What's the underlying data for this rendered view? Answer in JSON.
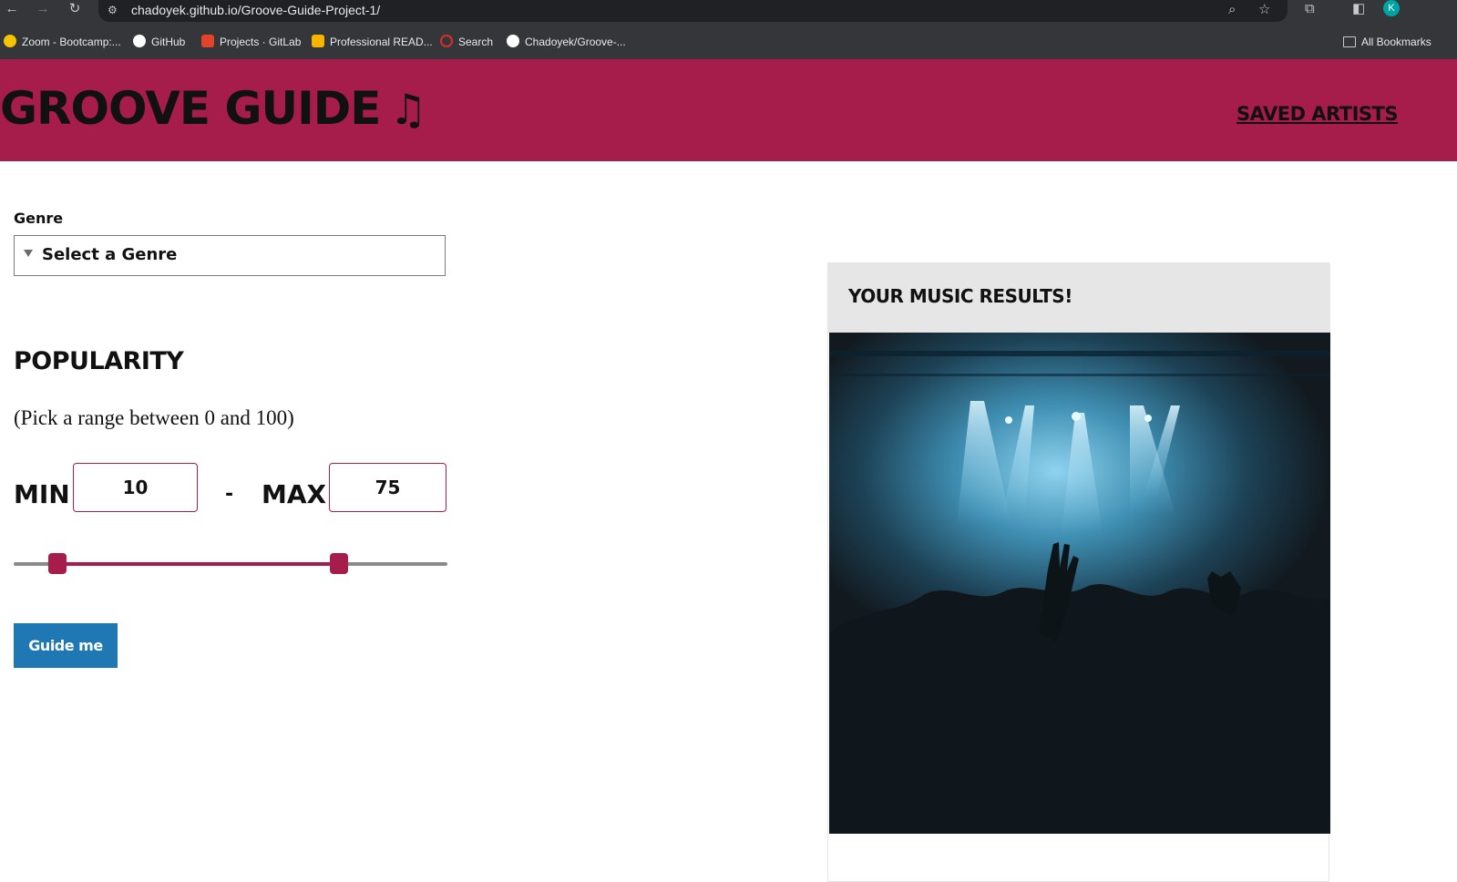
{
  "browser": {
    "url": "chadoyek.github.io/Groove-Guide-Project-1/",
    "profile_initial": "K"
  },
  "bookmarks": [
    {
      "label": "Zoom - Bootcamp:...",
      "icon": "zoom-icon",
      "color": "#f5c400"
    },
    {
      "label": "GitHub",
      "icon": "github-icon",
      "color": "#ffffff"
    },
    {
      "label": "Projects · GitLab",
      "icon": "gitlab-icon",
      "color": "#e24329"
    },
    {
      "label": "Professional READ...",
      "icon": "readme-icon",
      "color": "#f7b500"
    },
    {
      "label": "Search",
      "icon": "search-icon",
      "color": "#d93025"
    },
    {
      "label": "Chadoyek/Groove-...",
      "icon": "github-icon",
      "color": "#ffffff"
    }
  ],
  "all_bookmarks": "All Bookmarks",
  "header": {
    "title": "Groove Guide",
    "note": "♫",
    "saved_link": "Saved Artists",
    "color": "#a61c4b"
  },
  "form": {
    "genre_label": "Genre",
    "genre_placeholder": "Select a Genre",
    "popularity_title": "Popularity",
    "popularity_hint": "(Pick a range between 0 and 100)",
    "min_label": "Min",
    "min_value": "10",
    "dash": "-",
    "max_label": "Max",
    "max_value": "75",
    "slider_min": 10,
    "slider_max": 75,
    "slider_range": [
      0,
      100
    ],
    "button_label": "Guide me",
    "button_color": "#1f78b4"
  },
  "results": {
    "title": "Your Music Results!",
    "image": "concert-crowd-image"
  }
}
